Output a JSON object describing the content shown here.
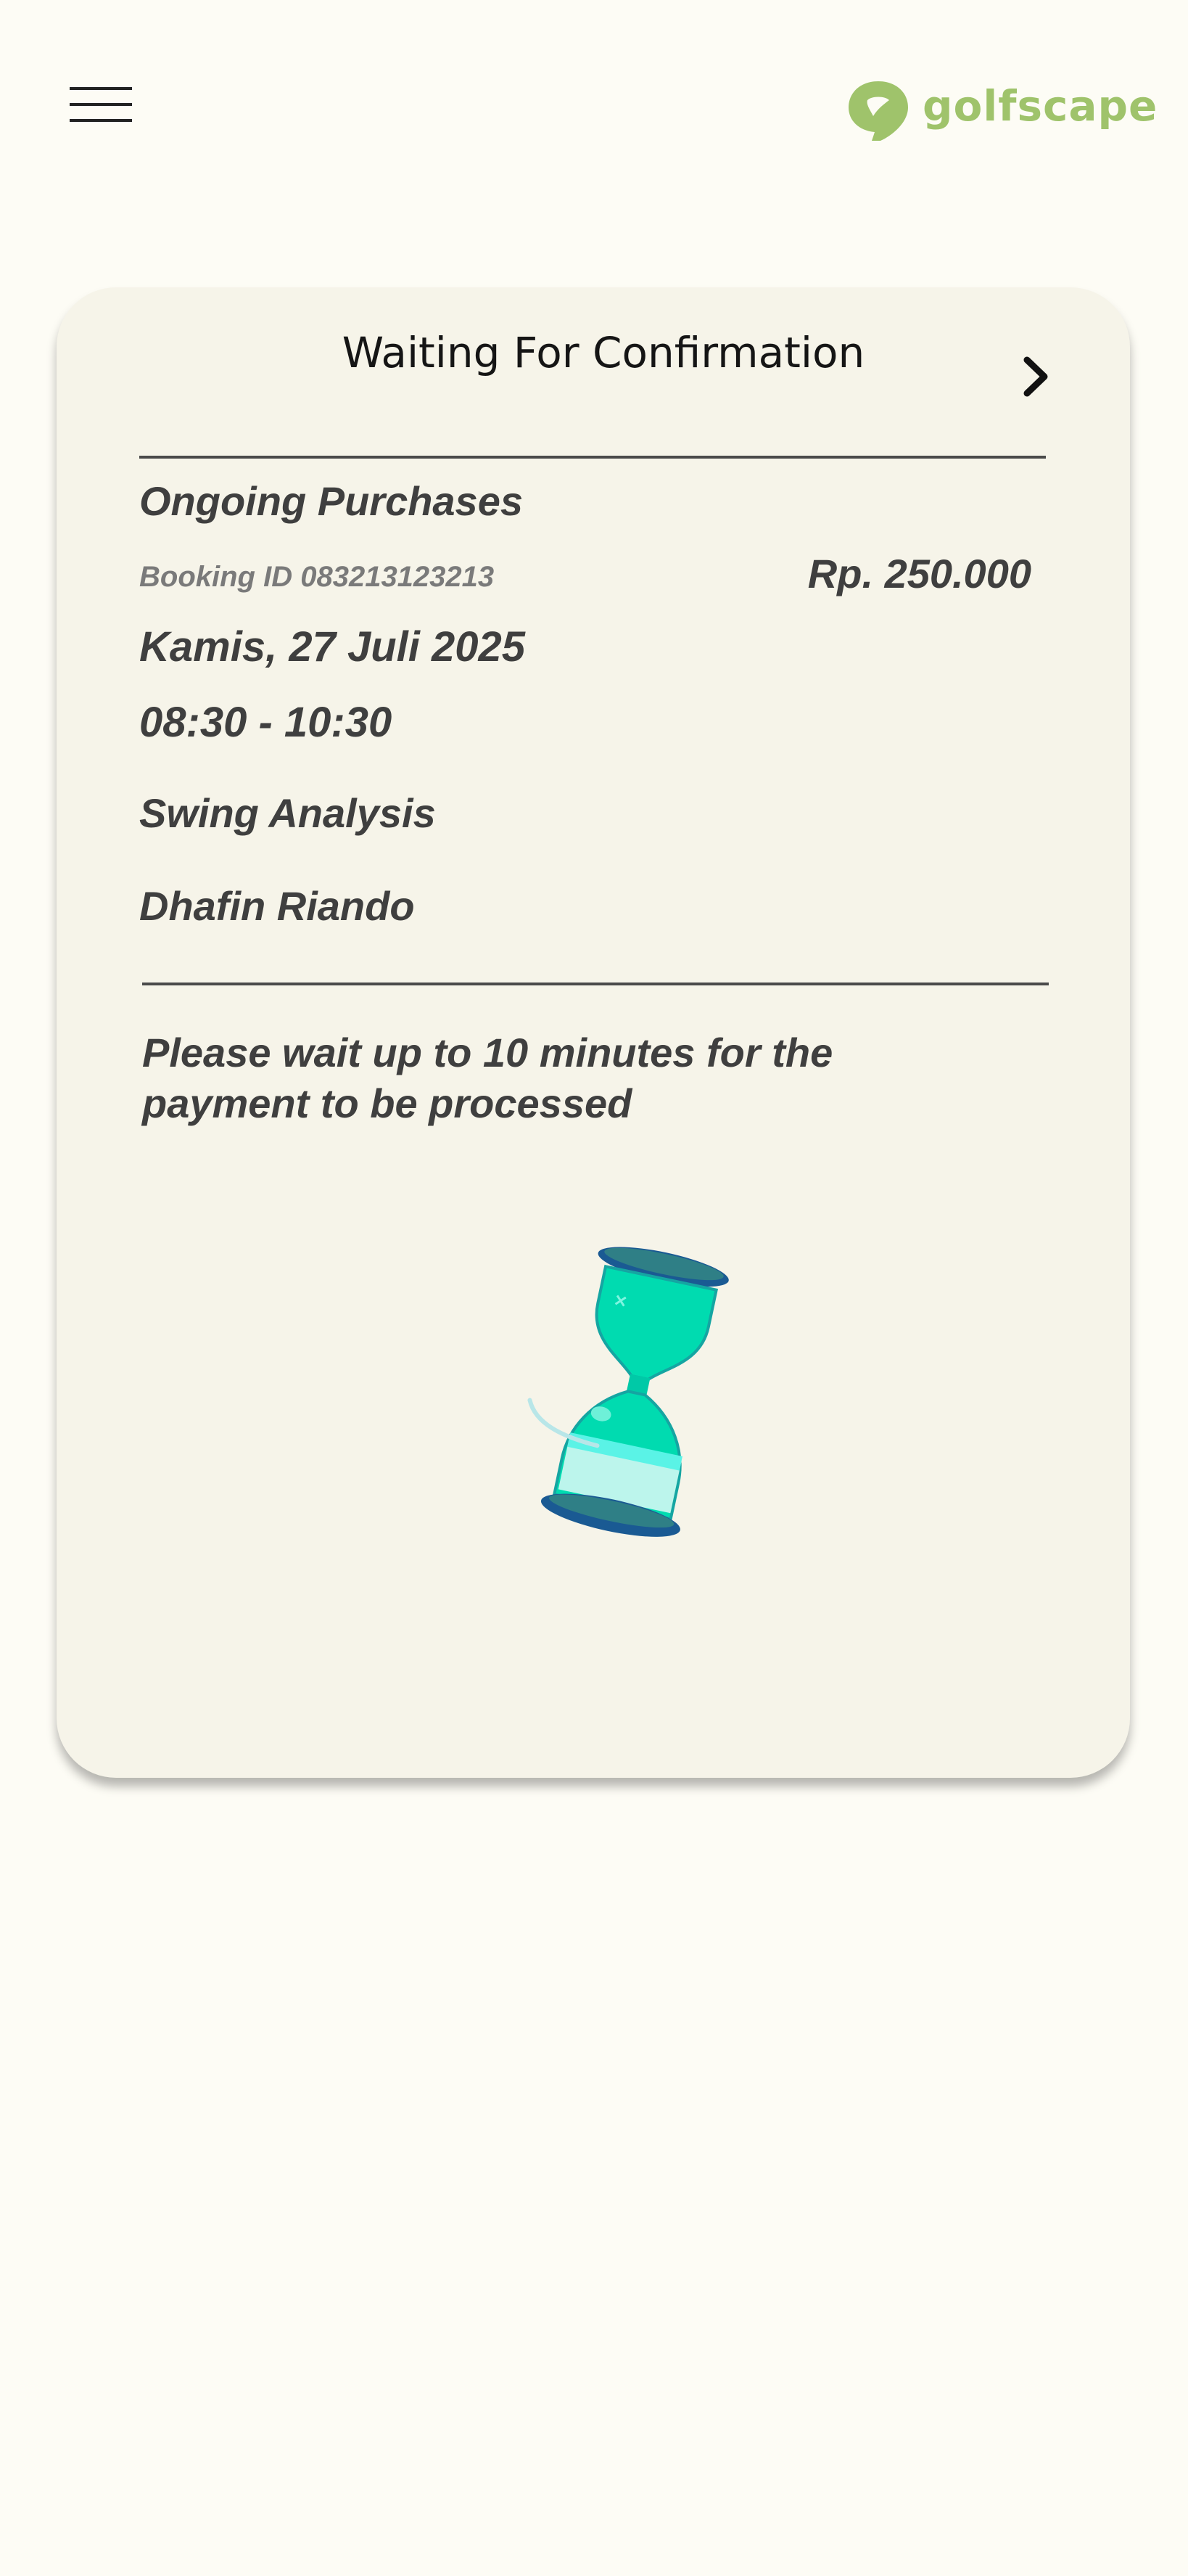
{
  "header": {
    "menu_icon": "hamburger-menu-icon",
    "logo_icon": "golfscape-pin-icon",
    "logo_text": "golfscape",
    "brand_color": "#9fc36b"
  },
  "card": {
    "title": "Waiting For Confirmation",
    "next_icon": "chevron-right-icon",
    "section_label": "Ongoing Purchases",
    "booking_id": "Booking ID 083213123213",
    "price": "Rp. 250.000",
    "date": "Kamis, 27 Juli 2025",
    "time": "08:30 - 10:30",
    "service": "Swing Analysis",
    "coach": "Dhafin Riando",
    "note": "Please wait up to 10 minutes for the payment to be processed",
    "status_icon": "hourglass-icon",
    "accent_color": "#00dbb0"
  }
}
